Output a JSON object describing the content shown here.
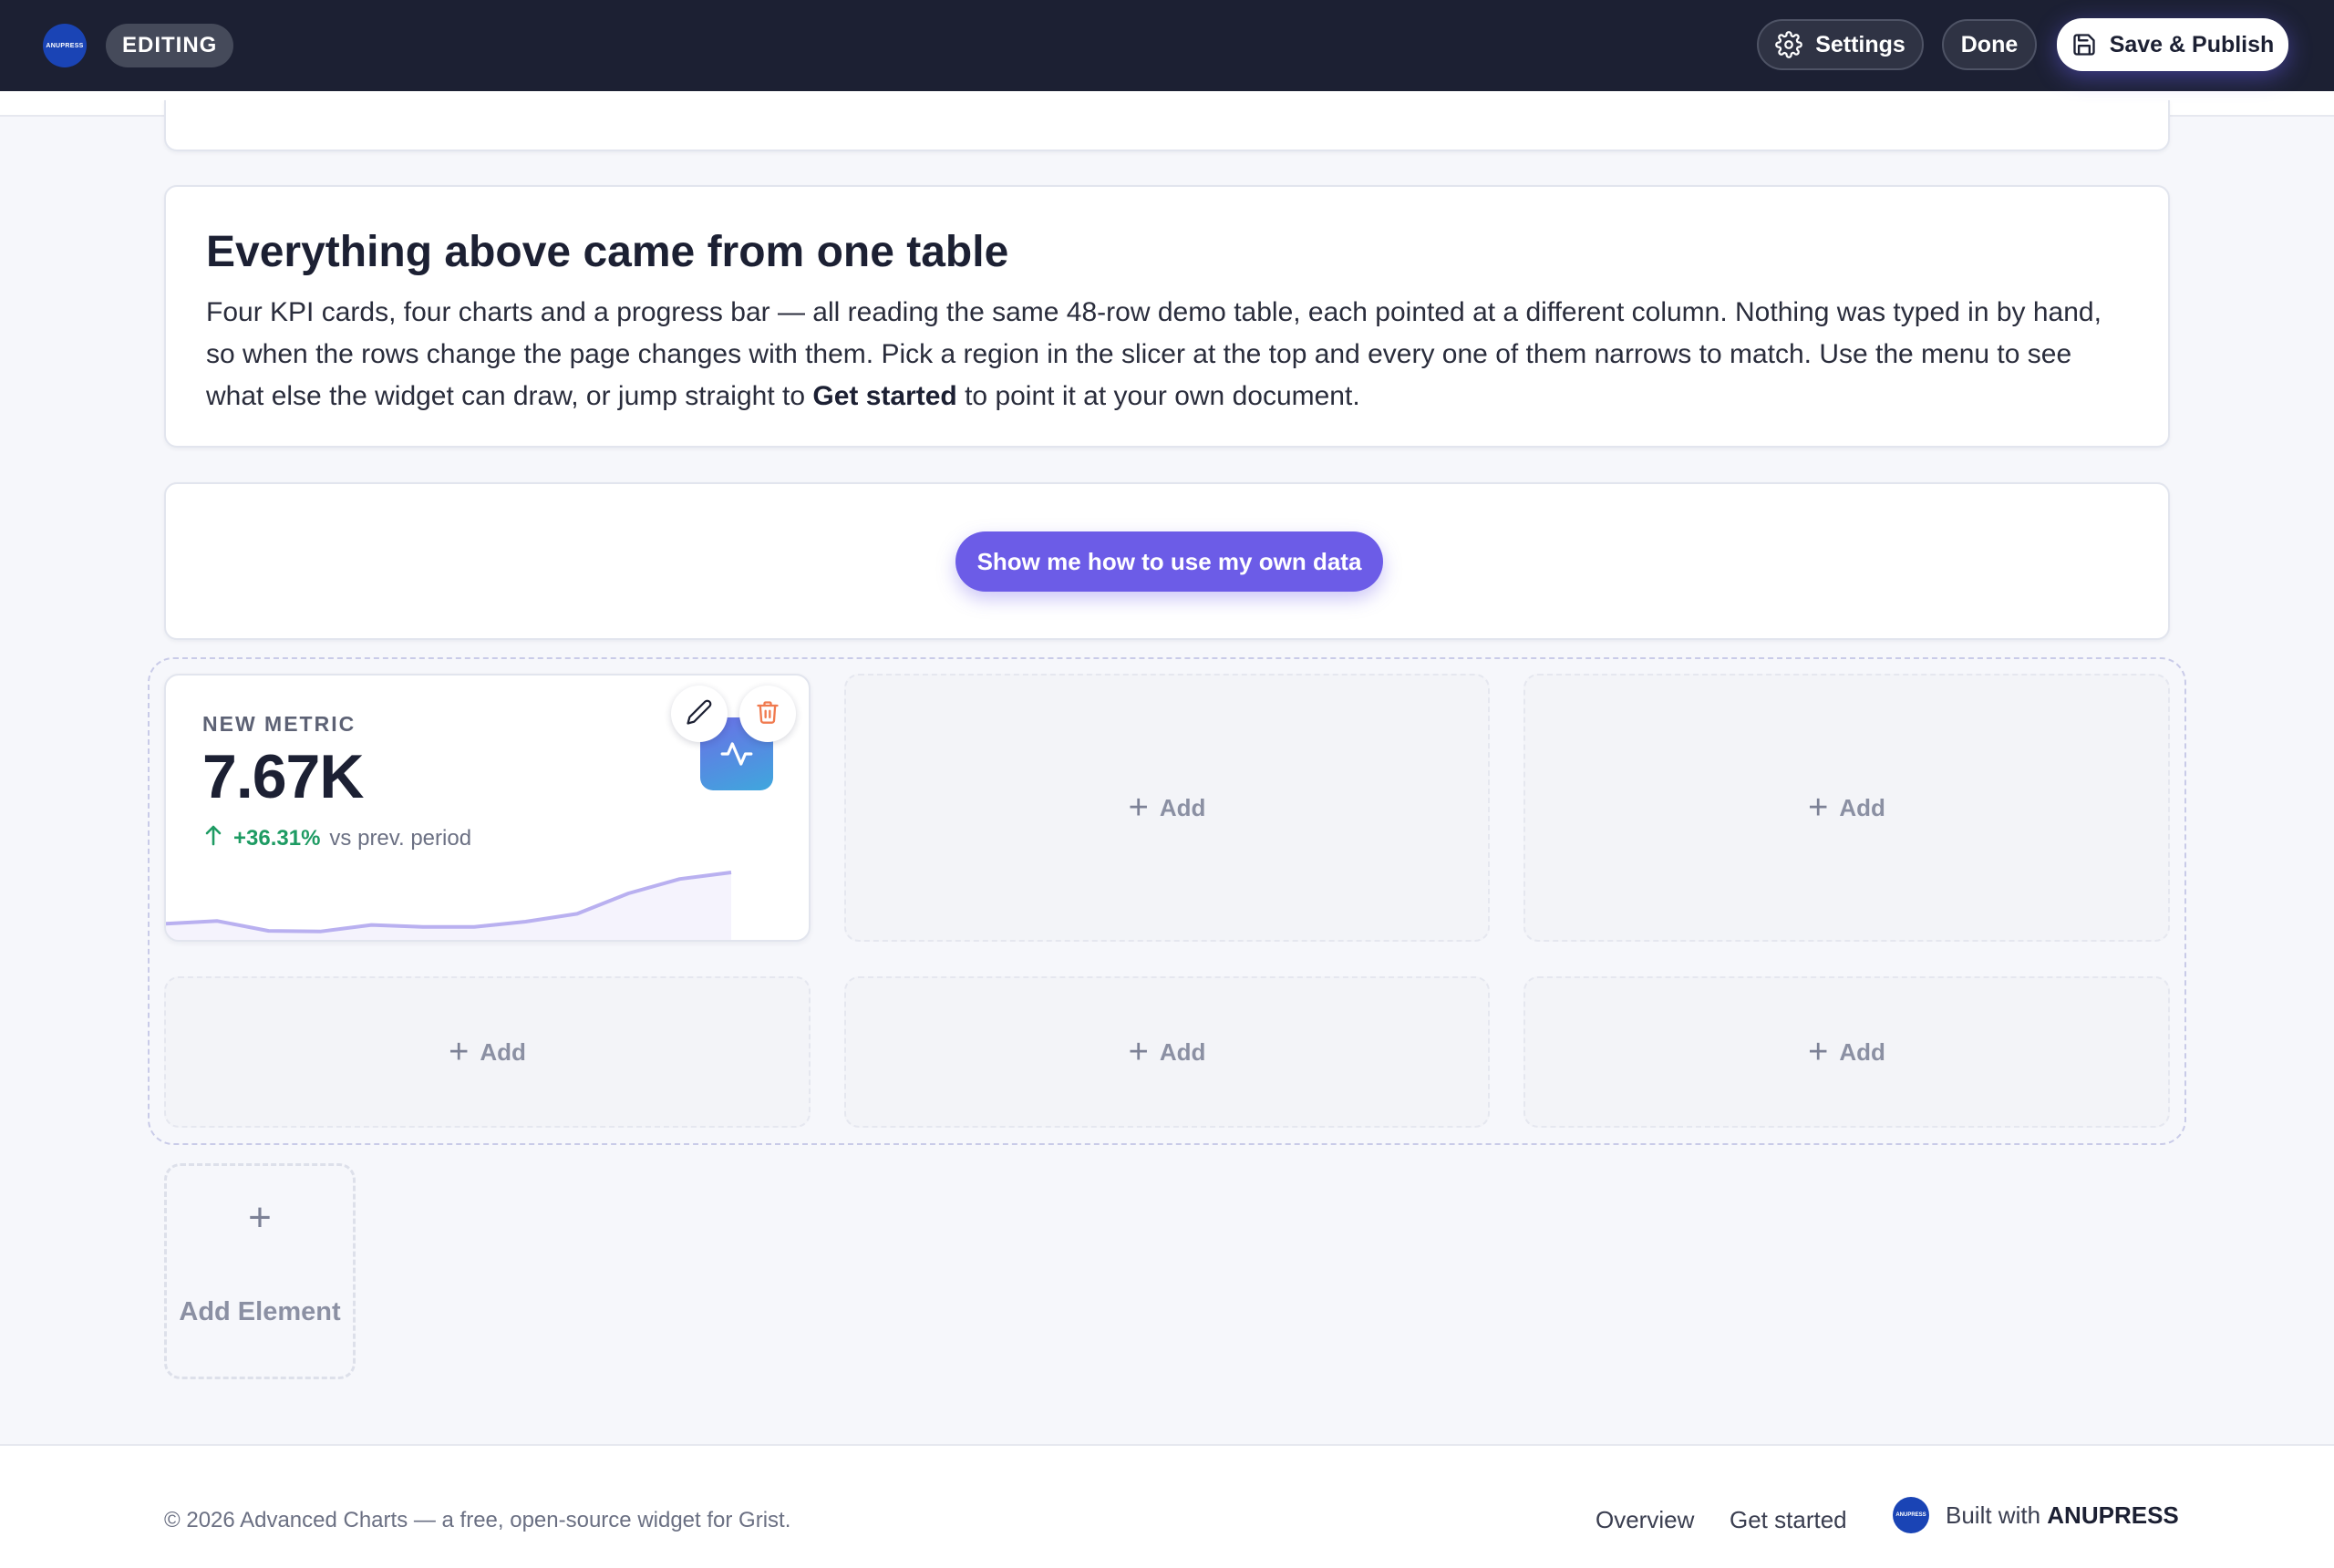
{
  "topbar": {
    "logo_text": "ANUPRESS",
    "mode_badge": "EDITING",
    "settings_label": "Settings",
    "done_label": "Done",
    "save_label": "Save & Publish"
  },
  "info_card": {
    "title": "Everything above came from one table",
    "body_1": "Four KPI cards, four charts and a progress bar — all reading the same 48-row demo table, each pointed at a different column. Nothing was typed in by hand, so when the rows change the page changes with them. Pick a region in the slicer at the top and every one of them narrows to match. Use the menu to see what else the widget can draw, or jump straight to ",
    "body_bold": "Get started",
    "body_2": " to point it at your own document."
  },
  "cta": {
    "label": "Show me how to use my own data"
  },
  "metric_card": {
    "label": "NEW METRIC",
    "value": "7.67K",
    "delta": "+36.31%",
    "delta_suffix": "vs prev. period",
    "delta_color": "#1e9b63",
    "spark_color": "#b9b0f0",
    "sparkline": [
      0.44,
      0.52,
      0.22,
      0.2,
      0.4,
      0.34,
      0.34,
      0.5,
      0.74,
      1.36,
      1.8,
      2.0
    ]
  },
  "grid_slots": [
    {
      "label": "Add"
    },
    {
      "label": "Add"
    },
    {
      "label": "Add"
    },
    {
      "label": "Add"
    },
    {
      "label": "Add"
    }
  ],
  "add_element": {
    "label": "Add Element"
  },
  "footer": {
    "copyright": "© 2026 Advanced Charts — a free, open-source widget for Grist.",
    "link_overview": "Overview",
    "link_get_started": "Get started",
    "built_prefix": "Built with",
    "built_brand": "ANUPRESS",
    "logo_text": "ANUPRESS"
  }
}
